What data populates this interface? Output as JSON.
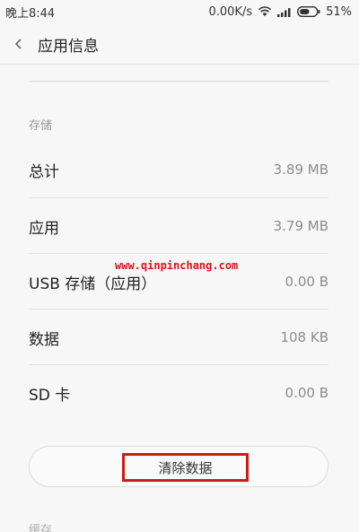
{
  "status_bar": {
    "time": "晚上8:44",
    "speed": "0.00K/s",
    "battery": "51%",
    "icons": [
      "wifi-icon",
      "signal-icon",
      "battery-icon"
    ]
  },
  "header": {
    "back_icon": "chevron-left-icon",
    "title": "应用信息"
  },
  "storage": {
    "section_label": "存储",
    "rows": [
      {
        "label": "总计",
        "value": "3.89 MB"
      },
      {
        "label": "应用",
        "value": "3.79 MB"
      },
      {
        "label": "USB 存储（应用）",
        "value": "0.00 B"
      },
      {
        "label": "数据",
        "value": "108 KB"
      },
      {
        "label": "SD 卡",
        "value": "0.00 B"
      }
    ]
  },
  "watermark": "www.qinpinchang.com",
  "clear_data_button": "清除数据",
  "next_section_label": "缓存",
  "colors": {
    "background": "#f7f7f7",
    "highlight_box": "#cc1b1b",
    "watermark": "#e0101a"
  }
}
